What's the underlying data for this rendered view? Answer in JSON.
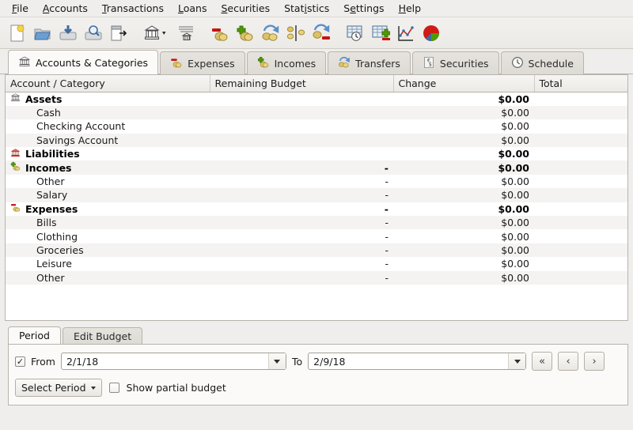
{
  "menubar": {
    "items": [
      {
        "label": "File",
        "mnemonic": "F"
      },
      {
        "label": "Accounts",
        "mnemonic": "A"
      },
      {
        "label": "Transactions",
        "mnemonic": "T"
      },
      {
        "label": "Loans",
        "mnemonic": "L"
      },
      {
        "label": "Securities",
        "mnemonic": "S"
      },
      {
        "label": "Statistics",
        "mnemonic": "i"
      },
      {
        "label": "Settings",
        "mnemonic": "e"
      },
      {
        "label": "Help",
        "mnemonic": "H"
      }
    ]
  },
  "toolbar": {
    "buttons": [
      {
        "name": "new-file-icon",
        "title": "New"
      },
      {
        "name": "open-folder-icon",
        "title": "Open"
      },
      {
        "name": "save-icon",
        "title": "Save"
      },
      {
        "name": "print-preview-icon",
        "title": "Print Preview"
      },
      {
        "name": "export-icon",
        "title": "Export"
      },
      {
        "name": "account-bank-dropdown-icon",
        "title": "Accounts"
      },
      {
        "name": "ledger-bank-icon",
        "title": "Ledger"
      },
      {
        "name": "expense-coins-icon",
        "title": "New Expense"
      },
      {
        "name": "income-coins-icon",
        "title": "New Income"
      },
      {
        "name": "transfer-coins-icon",
        "title": "New Transfer"
      },
      {
        "name": "split-coins-icon",
        "title": "Split"
      },
      {
        "name": "transfer-expense-icon",
        "title": "Transfer Expense"
      },
      {
        "name": "schedule-table-clock-icon",
        "title": "Schedule"
      },
      {
        "name": "budget-table-plus-icon",
        "title": "Budget"
      },
      {
        "name": "line-chart-icon",
        "title": "Chart"
      },
      {
        "name": "pie-chart-icon",
        "title": "Pie Chart"
      }
    ]
  },
  "tabs": {
    "items": [
      {
        "label": "Accounts & Categories",
        "icon": "bank-icon",
        "active": true
      },
      {
        "label": "Expenses",
        "icon": "expense-coins-icon",
        "active": false
      },
      {
        "label": "Incomes",
        "icon": "income-coins-icon",
        "active": false
      },
      {
        "label": "Transfers",
        "icon": "transfer-coins-icon",
        "active": false
      },
      {
        "label": "Securities",
        "icon": "currency-icon",
        "active": false
      },
      {
        "label": "Schedule",
        "icon": "clock-icon",
        "active": false
      }
    ]
  },
  "table": {
    "columns": [
      "Account / Category",
      "Remaining Budget",
      "Change",
      "Total"
    ],
    "rows": [
      {
        "name": "Assets",
        "icon": "bank-icon",
        "group": true,
        "indent": 0,
        "remaining": "",
        "change": "$0.00",
        "total": "$"
      },
      {
        "name": "Cash",
        "icon": "",
        "group": false,
        "indent": 1,
        "remaining": "",
        "change": "$0.00",
        "total": ""
      },
      {
        "name": "Checking Account",
        "icon": "",
        "group": false,
        "indent": 1,
        "remaining": "",
        "change": "$0.00",
        "total": ""
      },
      {
        "name": "Savings Account",
        "icon": "",
        "group": false,
        "indent": 1,
        "remaining": "",
        "change": "$0.00",
        "total": ""
      },
      {
        "name": "Liabilities",
        "icon": "liability-bank-icon",
        "group": true,
        "indent": 0,
        "remaining": "",
        "change": "$0.00",
        "total": "$"
      },
      {
        "name": "Incomes",
        "icon": "income-coins-icon",
        "group": true,
        "indent": 0,
        "remaining": "-",
        "change": "$0.00",
        "total": "$"
      },
      {
        "name": "Other",
        "icon": "",
        "group": false,
        "indent": 1,
        "remaining": "-",
        "change": "$0.00",
        "total": ""
      },
      {
        "name": "Salary",
        "icon": "",
        "group": false,
        "indent": 1,
        "remaining": "-",
        "change": "$0.00",
        "total": ""
      },
      {
        "name": "Expenses",
        "icon": "expense-coins-icon",
        "group": true,
        "indent": 0,
        "remaining": "-",
        "change": "$0.00",
        "total": "$"
      },
      {
        "name": "Bills",
        "icon": "",
        "group": false,
        "indent": 1,
        "remaining": "-",
        "change": "$0.00",
        "total": ""
      },
      {
        "name": "Clothing",
        "icon": "",
        "group": false,
        "indent": 1,
        "remaining": "-",
        "change": "$0.00",
        "total": ""
      },
      {
        "name": "Groceries",
        "icon": "",
        "group": false,
        "indent": 1,
        "remaining": "-",
        "change": "$0.00",
        "total": ""
      },
      {
        "name": "Leisure",
        "icon": "",
        "group": false,
        "indent": 1,
        "remaining": "-",
        "change": "$0.00",
        "total": ""
      },
      {
        "name": "Other",
        "icon": "",
        "group": false,
        "indent": 1,
        "remaining": "-",
        "change": "$0.00",
        "total": ""
      }
    ]
  },
  "bottom": {
    "tabs": [
      {
        "label": "Period",
        "active": true
      },
      {
        "label": "Edit Budget",
        "active": false
      }
    ],
    "from_label": "From",
    "from_checked": true,
    "from_value": "2/1/18",
    "to_label": "To",
    "to_value": "2/9/18",
    "nav": [
      {
        "name": "first-period-button",
        "glyph": "«"
      },
      {
        "name": "prev-period-button",
        "glyph": "‹"
      },
      {
        "name": "next-period-button",
        "glyph": "›"
      }
    ],
    "select_period_label": "Select Period",
    "show_partial_label": "Show partial budget",
    "show_partial_checked": false
  },
  "colors": {
    "accent_red": "#c3160f",
    "accent_green": "#4e9a06",
    "coin_gold": "#d8c068",
    "window_bg": "#efeeec",
    "table_alt": "#f4f3f1"
  }
}
